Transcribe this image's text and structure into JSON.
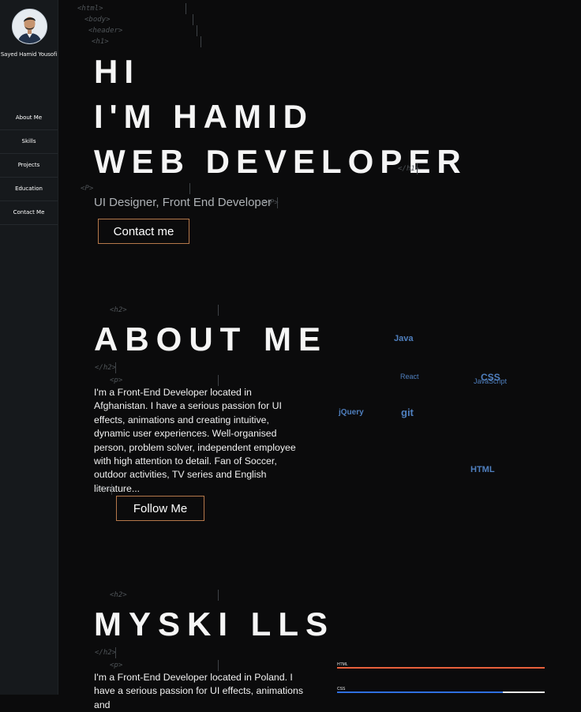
{
  "sidebar": {
    "name": "Sayed Hamid Yousofi",
    "nav": [
      "About Me",
      "Skills",
      "Projects",
      "Education",
      "Contact Me"
    ]
  },
  "tags": {
    "html": "<html>",
    "body": "<body>",
    "header": "<header>",
    "h1": "<h1>",
    "h1_close": "</h1>",
    "p": "<P>",
    "p_close": "</P>",
    "h2": "<h2>",
    "h2_close": "</h2>",
    "p_lower": "<p>",
    "p_lower_close": "</p>"
  },
  "hero": {
    "lines": [
      "HI",
      "I'M HAMID",
      "WEB DEVELOPER"
    ],
    "subtitle": "UI Designer, Front End Developer",
    "contact_label": "Contact me"
  },
  "about": {
    "title": "ABOUT ME",
    "text": "I'm a Front-End Developer located in Afghanistan. I have a serious passion for UI effects, animations and creating intuitive, dynamic user experiences. Well-organised person, problem solver, independent employee with high attention to detail. Fan of Soccer, outdoor activities, TV series and English literature...",
    "follow_label": "Follow Me",
    "word_cloud": [
      "Java",
      "React",
      "CSS",
      "JavaScript",
      "jQuery",
      "git",
      "HTML"
    ]
  },
  "skills": {
    "title": "MYSKI LLS",
    "text": "I'm a Front-End Developer located in Poland. I have a serious passion for UI effects, animations and",
    "bars": [
      {
        "name": "HTML",
        "level": 1.0,
        "color": "#e8603c"
      },
      {
        "name": "CSS",
        "level": 0.8,
        "color": "#2f6fe0"
      }
    ]
  },
  "colors": {
    "accent_border": "#b5784a",
    "cloud_blue": "#4f7fbe"
  }
}
